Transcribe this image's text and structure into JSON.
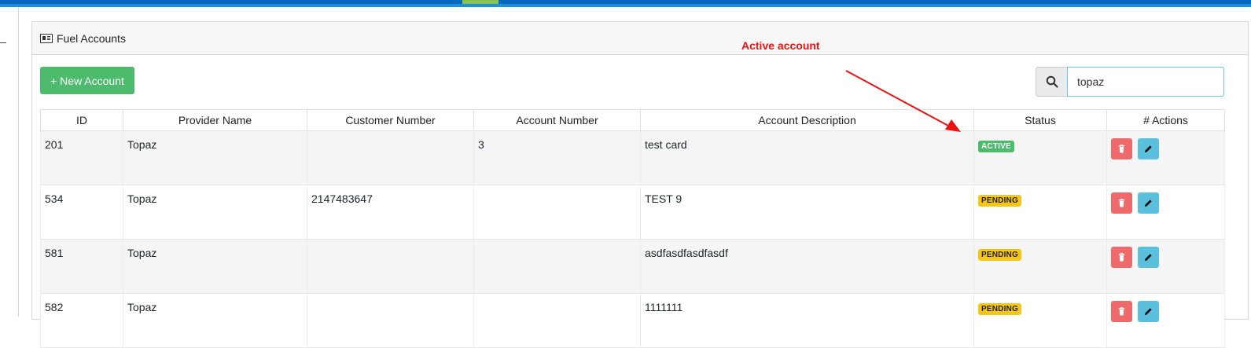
{
  "card": {
    "title": "Fuel Accounts"
  },
  "toolbar": {
    "new_account_label": "+ New Account"
  },
  "search": {
    "value": "topaz",
    "icon": "search-icon"
  },
  "annotation": {
    "label": "Active account",
    "color": "#ee1111"
  },
  "table": {
    "columns": [
      "ID",
      "Provider Name",
      "Customer Number",
      "Account Number",
      "Account Description",
      "Status",
      "# Actions"
    ],
    "rows": [
      {
        "id": "201",
        "provider": "Topaz",
        "customer": "",
        "account": "3",
        "description": "test card",
        "status": "ACTIVE"
      },
      {
        "id": "534",
        "provider": "Topaz",
        "customer": "2147483647",
        "account": "",
        "description": "TEST 9",
        "status": "PENDING"
      },
      {
        "id": "581",
        "provider": "Topaz",
        "customer": "",
        "account": "",
        "description": "asdfasdfasdfasdf",
        "status": "PENDING"
      },
      {
        "id": "582",
        "provider": "Topaz",
        "customer": "",
        "account": "",
        "description": "1111111",
        "status": "PENDING"
      }
    ]
  },
  "colors": {
    "primary_bar": "#0b68b8",
    "success": "#4cbb6c",
    "warning": "#f5c518",
    "danger": "#ef6b6b",
    "info": "#5bc0de"
  }
}
